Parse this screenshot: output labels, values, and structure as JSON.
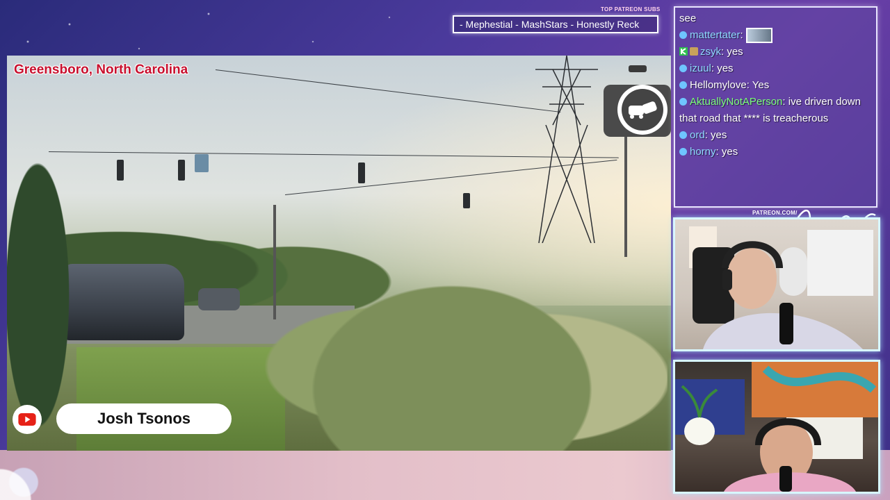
{
  "overlay": {
    "ticker_label": "TOP PATREON SUBS",
    "ticker_text": "- Mephestial - MashStars - Honestly Reck",
    "patreon_text": "PATREON.COM/"
  },
  "video": {
    "location": "Greensboro, North Carolina",
    "channel_name": "Josh Tsonos",
    "icons": {
      "brand": "youtube-icon",
      "badge": "dashcam-crash-icon"
    }
  },
  "chat": {
    "messages": [
      {
        "user": "",
        "text": "see"
      },
      {
        "user": "mattertater",
        "text": "",
        "emote": true
      },
      {
        "user": "zsyk",
        "text": "yes",
        "green": false,
        "badges": true
      },
      {
        "user": "izuul",
        "text": "yes"
      },
      {
        "user": "Hellomylove",
        "text": "Yes",
        "white": true
      },
      {
        "user": "AktuallyNotAPerson",
        "text": "ive driven down that road that **** is treacherous",
        "green": true
      },
      {
        "user": "ord",
        "text": "yes"
      },
      {
        "user": "horny",
        "text": "yes"
      }
    ]
  },
  "colors": {
    "location_text": "#c8102e",
    "chat_user": "#8fd8ff",
    "chat_user_green": "#7cff7c",
    "cam_border": "#d8f7ff"
  }
}
